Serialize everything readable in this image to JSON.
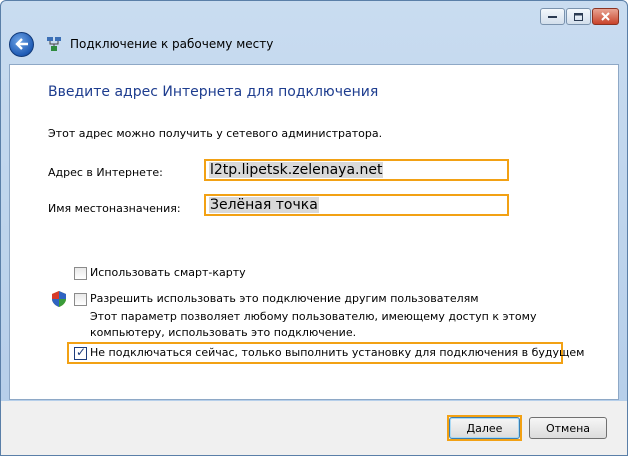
{
  "window": {
    "title": "Подключение к рабочему месту",
    "controls": [
      "minimize-icon",
      "maximize-icon",
      "close-icon"
    ]
  },
  "page": {
    "heading": "Введите адрес Интернета для подключения",
    "hint": "Этот адрес можно получить у сетевого администратора."
  },
  "form": {
    "address_label": "Адрес в Интернете:",
    "address_value": "l2tp.lipetsk.zelenaya.net",
    "destination_label": "Имя местоназначения:",
    "destination_value": "Зелёная точка"
  },
  "options": {
    "smartcard_label": "Использовать смарт-карту",
    "smartcard_checked": false,
    "share_label": "Разрешить использовать это подключение другим пользователям",
    "share_checked": false,
    "share_desc": "Этот параметр позволяет любому пользователю, имеющему доступ к этому компьютеру, использовать это подключение.",
    "later_label": "Не подключаться сейчас, только выполнить установку для подключения в будущем",
    "later_checked": true
  },
  "buttons": {
    "next": "Далее",
    "cancel": "Отмена"
  },
  "colors": {
    "accent_highlight": "#f2a114",
    "heading": "#1e3d8f"
  }
}
